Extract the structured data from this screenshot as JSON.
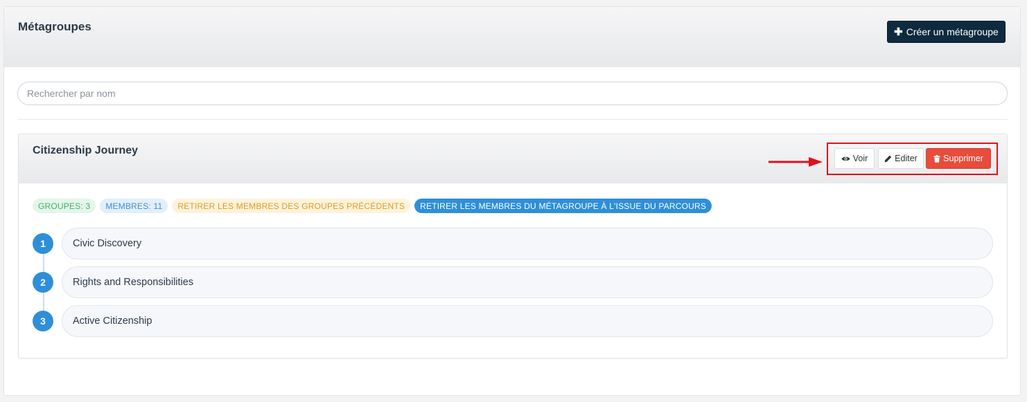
{
  "header": {
    "title": "Métagroupes",
    "create_button_label": "Créer un métagroupe"
  },
  "search": {
    "placeholder": "Rechercher par nom",
    "value": ""
  },
  "metagroup": {
    "title": "Citizenship Journey",
    "actions": {
      "view_label": "Voir",
      "edit_label": "Editer",
      "delete_label": "Supprimer"
    },
    "badges": {
      "groups": "GROUPES: 3",
      "members": "MEMBRES: 11",
      "remove_previous": "RETIRER LES MEMBRES DES GROUPES PRÉCÉDENTS",
      "remove_end": "RETIRER LES MEMBRES DU MÉTAGROUPE À L'ISSUE DU PARCOURS"
    },
    "steps": [
      {
        "number": "1",
        "label": "Civic Discovery"
      },
      {
        "number": "2",
        "label": "Rights and Responsibilities"
      },
      {
        "number": "3",
        "label": "Active Citizenship"
      }
    ]
  },
  "icons": {
    "create": "plus-icon",
    "view": "eye-icon",
    "edit": "pencil-icon",
    "delete": "trash-icon",
    "annotation": "arrow-right-icon"
  },
  "colors": {
    "primary_dark": "#0e2a3e",
    "danger": "#e74c3c",
    "step_blue": "#2e8fd8",
    "annotation_red": "#e0111b"
  }
}
